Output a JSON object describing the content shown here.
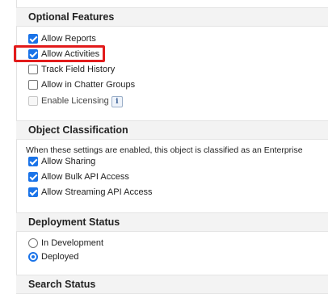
{
  "optional_features": {
    "title": "Optional Features",
    "items": [
      {
        "label": "Allow Reports",
        "checked": true,
        "disabled": false
      },
      {
        "label": "Allow Activities",
        "checked": true,
        "disabled": false
      },
      {
        "label": "Track Field History",
        "checked": false,
        "disabled": false
      },
      {
        "label": "Allow in Chatter Groups",
        "checked": false,
        "disabled": false
      },
      {
        "label": "Enable Licensing",
        "checked": false,
        "disabled": true
      }
    ],
    "info_icon": "i"
  },
  "object_classification": {
    "title": "Object Classification",
    "note": "When these settings are enabled, this object is classified as an Enterprise",
    "items": [
      {
        "label": "Allow Sharing",
        "checked": true
      },
      {
        "label": "Allow Bulk API Access",
        "checked": true
      },
      {
        "label": "Allow Streaming API Access",
        "checked": true
      }
    ]
  },
  "deployment_status": {
    "title": "Deployment Status",
    "options": [
      {
        "label": "In Development",
        "selected": false
      },
      {
        "label": "Deployed",
        "selected": true
      }
    ]
  },
  "search_status": {
    "title": "Search Status"
  },
  "colors": {
    "accent": "#1a73e8",
    "highlight": "#e21b1b",
    "section_bg": "#f3f3f3"
  }
}
